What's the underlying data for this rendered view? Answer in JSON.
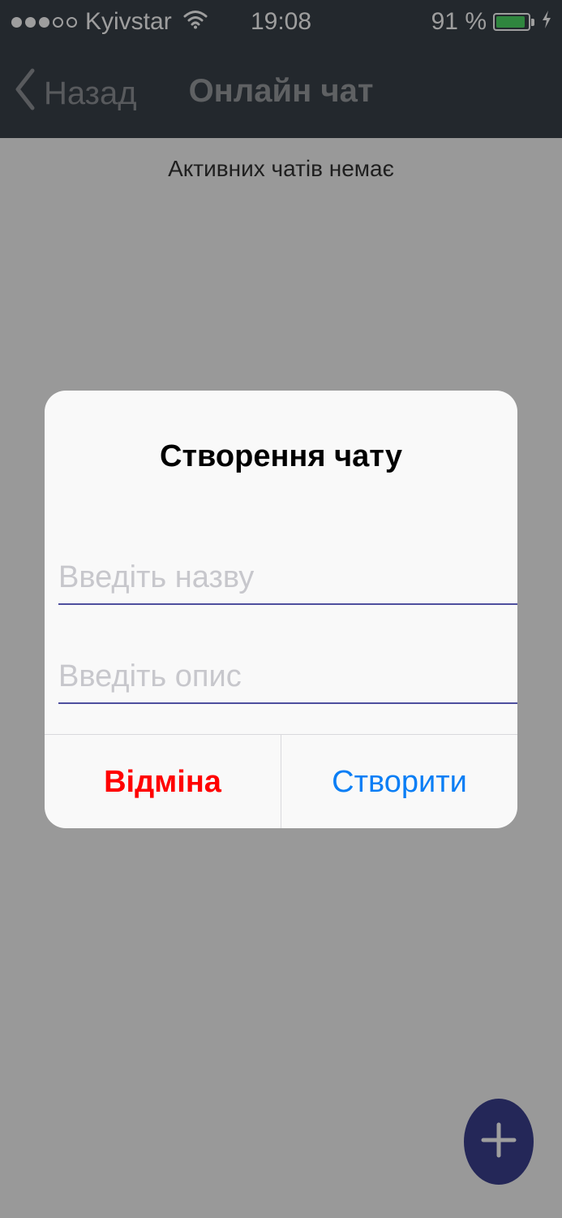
{
  "status_bar": {
    "carrier": "Kyivstar",
    "time": "19:08",
    "battery_percent": "91 %",
    "battery_level": 0.91,
    "signal": {
      "filled": 3,
      "total": 5
    },
    "icons": [
      "wifi-icon",
      "battery-icon",
      "charging-bolt-icon"
    ]
  },
  "nav": {
    "back_label": "Назад",
    "title": "Онлайн чат",
    "back_icon": "chevron-left-icon"
  },
  "main": {
    "empty_text": "Активних чатів немає",
    "fab_icon": "plus-icon"
  },
  "dialog": {
    "title": "Створення чату",
    "name_placeholder": "Введіть назву",
    "description_placeholder": "Введіть опис",
    "name_value": "",
    "description_value": "",
    "cancel_label": "Відміна",
    "create_label": "Створити"
  },
  "colors": {
    "nav_background": "#39414a",
    "cancel": "#ff0000",
    "create": "#0a7ef5",
    "input_underline": "#4e4f9e",
    "fab": "#3a3f8f",
    "battery_fill": "#4cd964"
  }
}
